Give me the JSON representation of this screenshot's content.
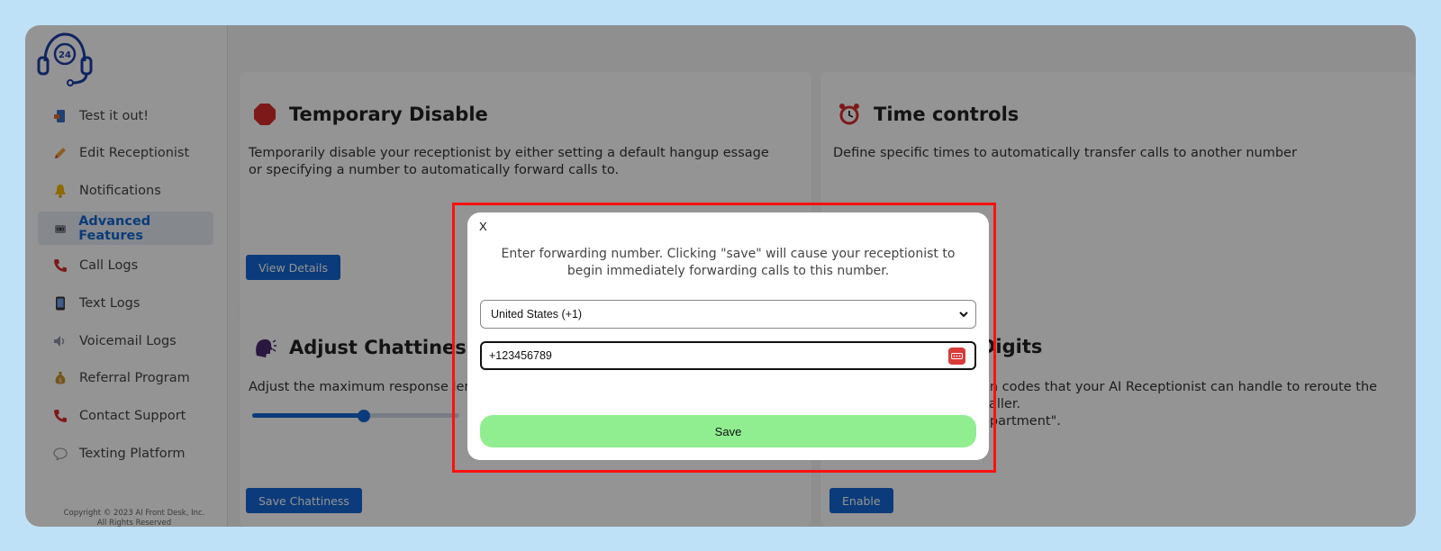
{
  "sidebar": {
    "items": [
      {
        "label": "Test it out!",
        "icon": "phone-device-icon"
      },
      {
        "label": "Edit Receptionist",
        "icon": "pencil-icon"
      },
      {
        "label": "Notifications",
        "icon": "bell-icon"
      },
      {
        "label": "Advanced Features",
        "icon": "robot-icon"
      },
      {
        "label": "Call Logs",
        "icon": "phone-icon"
      },
      {
        "label": "Text Logs",
        "icon": "mobile-icon"
      },
      {
        "label": "Voicemail Logs",
        "icon": "speaker-icon"
      },
      {
        "label": "Referral Program",
        "icon": "money-bag-icon"
      },
      {
        "label": "Contact Support",
        "icon": "phone-icon"
      },
      {
        "label": "Texting Platform",
        "icon": "speech-bubble-icon"
      }
    ],
    "active_index": 3,
    "copyright_line1": "Copyright © 2023 AI Front Desk, Inc.",
    "copyright_line2": "All Rights Reserved"
  },
  "cards": {
    "temporary_disable": {
      "title": "Temporary Disable",
      "description": "Temporarily disable your receptionist by either setting a default hangup essage or specifying a number to automatically forward calls to.",
      "button": "View Details"
    },
    "time_controls": {
      "title": "Time controls",
      "description": "Define specific times to automatically transfer calls to another number"
    },
    "adjust_chattiness": {
      "title": "Adjust Chattiness",
      "description": "Adjust the maximum response leng",
      "button": "Save Chattiness",
      "slider_value": 0.54
    },
    "digits": {
      "title": "Digits",
      "description_line1": "on codes that your AI Receptionist can handle to reroute the caller.",
      "description_line2": "epartment\".",
      "button": "Enable"
    }
  },
  "modal": {
    "close_label": "X",
    "message": "Enter forwarding number. Clicking \"save\" will cause your receptionist to begin immediately forwarding calls to this number.",
    "country_selected": "United States (+1)",
    "phone_value": "+123456789",
    "save_label": "Save"
  },
  "colors": {
    "accent": "#1466d2",
    "save_button": "#90ee90",
    "highlight": "#ff1010",
    "background": "#bfe1f7"
  }
}
